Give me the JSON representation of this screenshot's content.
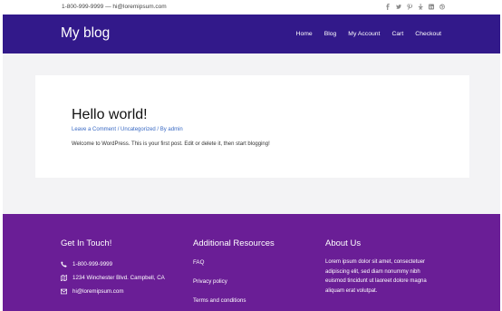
{
  "topbar": {
    "contact": "1-800-999-9999 — hi@loremipsum.com",
    "socials": [
      "facebook-icon",
      "twitter-icon",
      "pinterest-icon",
      "yelp-icon",
      "linkedin-icon",
      "dribbble-icon"
    ]
  },
  "header": {
    "brand": "My blog",
    "nav": [
      "Home",
      "Blog",
      "My Account",
      "Cart",
      "Checkout"
    ]
  },
  "post": {
    "title": "Hello world!",
    "meta_comment": "Leave a Comment",
    "meta_sep1": " / ",
    "meta_category": "Uncategorized",
    "meta_sep2": " / By ",
    "meta_author": "admin",
    "excerpt": "Welcome to WordPress. This is your first post. Edit or delete it, then start blogging!"
  },
  "footer": {
    "col1": {
      "title": "Get In Touch!",
      "phone": "1-800-999-9999",
      "address": "1234 Winchester Blvd. Campbell, CA",
      "email": "hi@loremipsum.com"
    },
    "col2": {
      "title": "Additional Resources",
      "links": [
        "FAQ",
        "Privacy policy",
        "Terms and conditions"
      ]
    },
    "col3": {
      "title": "About Us",
      "text": "Lorem ipsum dolor sit amet, consectetuer adipiscing elit, sed diam nonummy nibh euismod tincidunt ut laoreet dolore magna aliquam erat volutpat."
    }
  },
  "colors": {
    "header_bg": "#32198a",
    "footer_bg": "#6a1e96",
    "main_bg": "#f3f3f5",
    "link": "#3a6ac4"
  }
}
